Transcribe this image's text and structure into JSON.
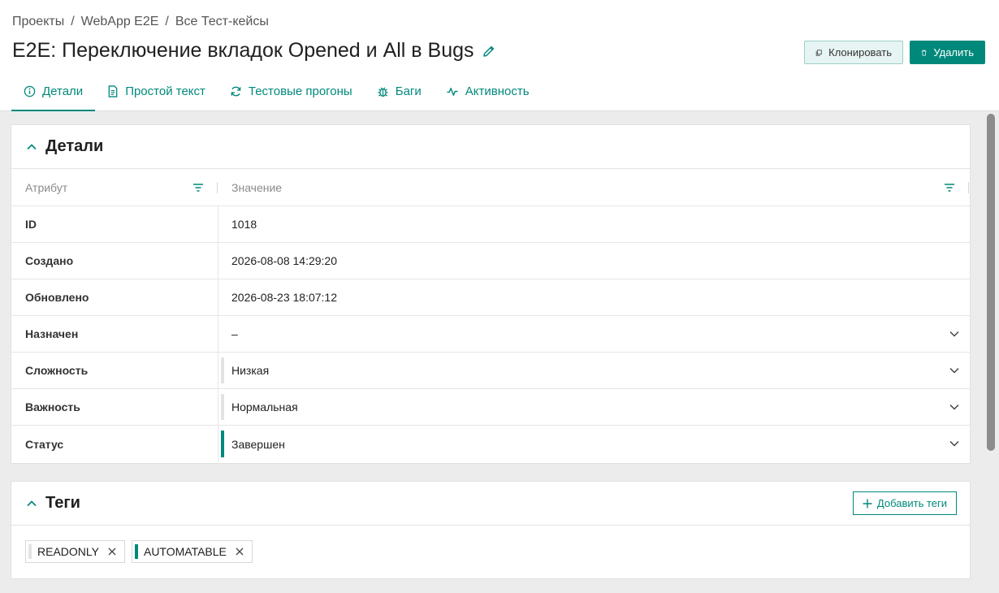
{
  "breadcrumb": [
    "Проекты",
    "WebApp E2E",
    "Все Тест-кейсы"
  ],
  "page_title": "E2E: Переключение вкладок Opened и All в Bugs",
  "actions": {
    "clone_label": "Клонировать",
    "delete_label": "Удалить"
  },
  "tabs": [
    {
      "label": "Детали",
      "icon": "info-icon",
      "active": true
    },
    {
      "label": "Простой текст",
      "icon": "document-icon",
      "active": false
    },
    {
      "label": "Тестовые прогоны",
      "icon": "refresh-icon",
      "active": false
    },
    {
      "label": "Баги",
      "icon": "bug-icon",
      "active": false
    },
    {
      "label": "Активность",
      "icon": "activity-icon",
      "active": false
    }
  ],
  "details": {
    "title": "Детали",
    "columns": {
      "attribute": "Атрибут",
      "value": "Значение"
    },
    "rows": [
      {
        "label": "ID",
        "value": "1018"
      },
      {
        "label": "Создано",
        "value": "2026-08-08 14:29:20"
      },
      {
        "label": "Обновлено",
        "value": "2026-08-23 18:07:12"
      },
      {
        "label": "Назначен",
        "value": "–"
      },
      {
        "label": "Сложность",
        "value": "Низкая"
      },
      {
        "label": "Важность",
        "value": "Нормальная"
      },
      {
        "label": "Статус",
        "value": "Завершен"
      }
    ]
  },
  "tags": {
    "title": "Теги",
    "add_label": "Добавить теги",
    "items": [
      "READONLY",
      "AUTOMATABLE"
    ]
  },
  "colors": {
    "accent": "#00897b",
    "accent_light": "#e6f4f3",
    "background": "#ececec"
  }
}
